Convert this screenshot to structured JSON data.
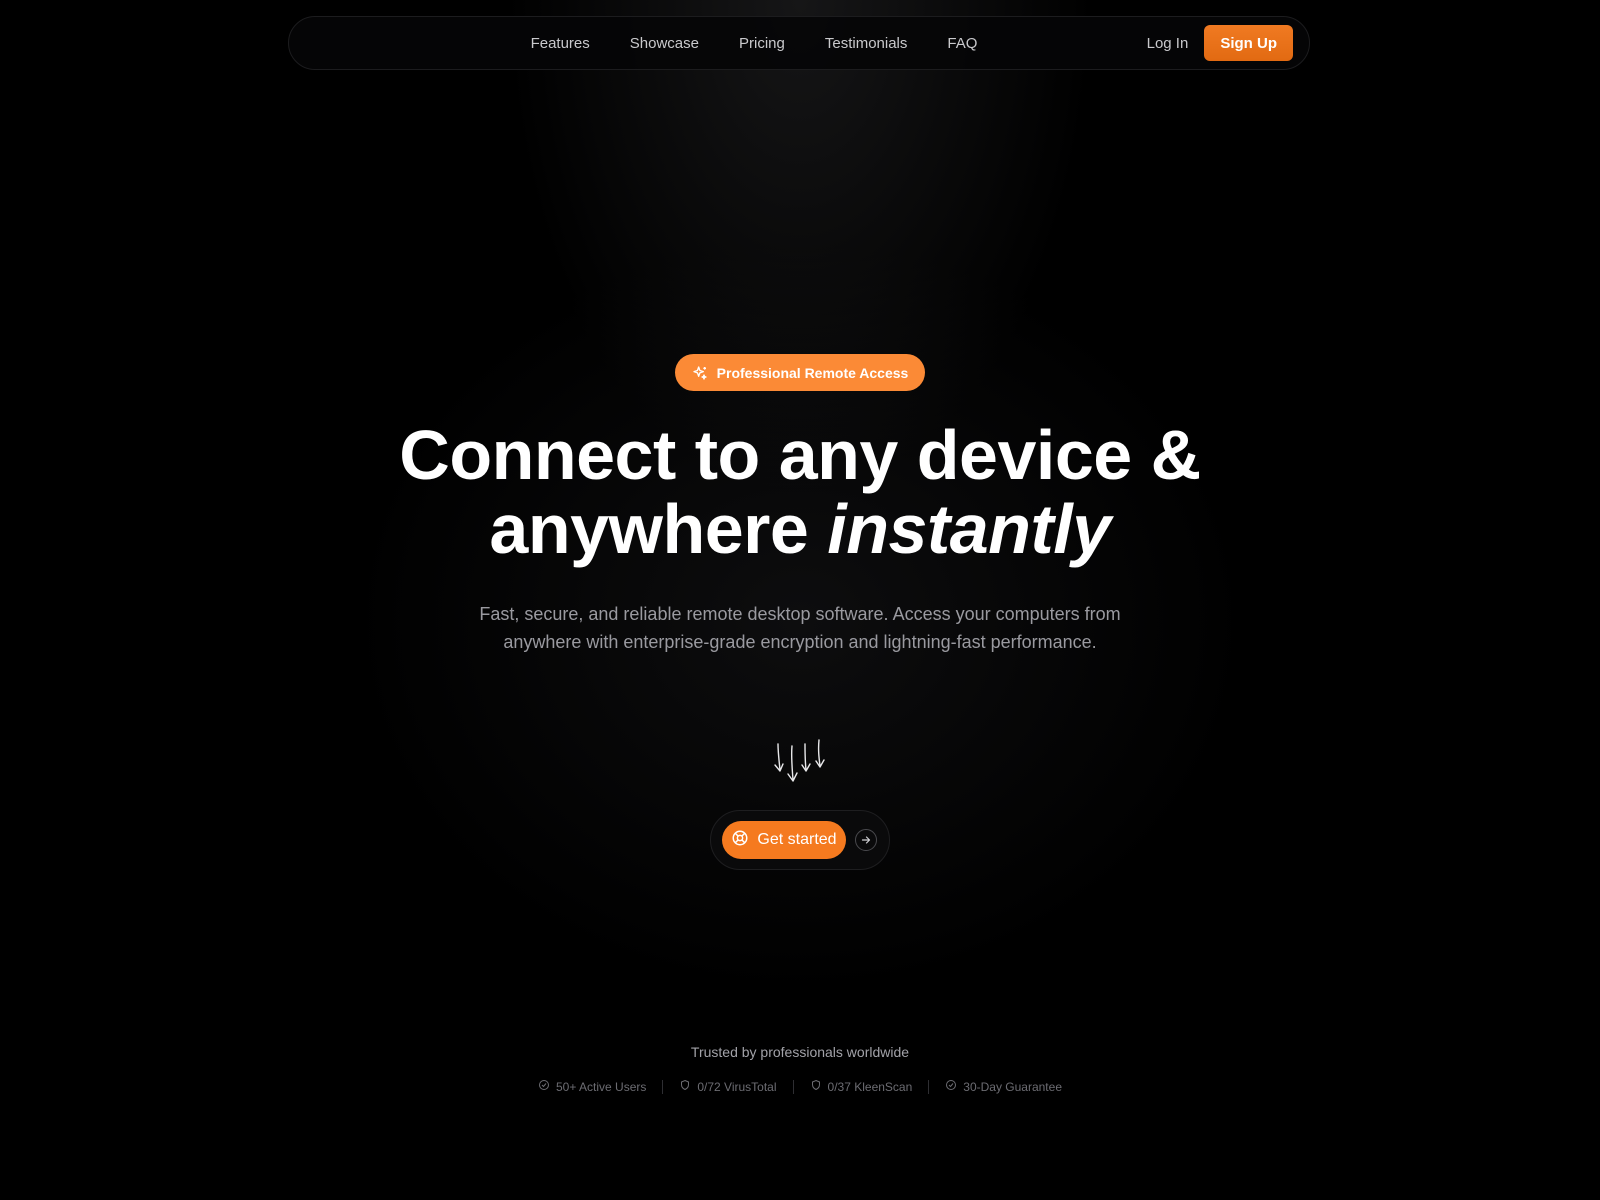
{
  "nav": {
    "links": [
      "Features",
      "Showcase",
      "Pricing",
      "Testimonials",
      "FAQ"
    ],
    "login_label": "Log In",
    "signup_label": "Sign Up"
  },
  "hero": {
    "badge_label": "Professional Remote Access",
    "headline_line1": "Connect to any device &",
    "headline_line2_plain": "anywhere",
    "headline_line2_italic": "instantly",
    "subtext_line1": "Fast, secure, and reliable remote desktop software. Access your computers from",
    "subtext_line2": "anywhere with enterprise-grade encryption and lightning-fast performance.",
    "cta_label": "Get started"
  },
  "trust": {
    "title": "Trusted by professionals worldwide",
    "stats": [
      {
        "label": "50+ Active Users",
        "icon": "check-circle-icon"
      },
      {
        "label": "0/72 VirusTotal",
        "icon": "shield-icon"
      },
      {
        "label": "0/37 KleenScan",
        "icon": "shield-icon"
      },
      {
        "label": "30-Day Guarantee",
        "icon": "check-circle-icon"
      }
    ]
  },
  "colors": {
    "accent": "#f57a1f",
    "badge": "#fb8a36",
    "background": "#000000"
  }
}
